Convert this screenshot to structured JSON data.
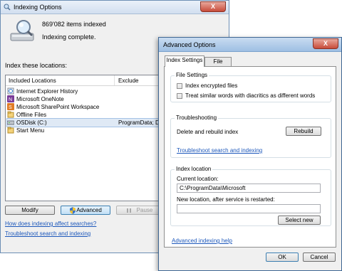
{
  "indexing_window": {
    "title": "Indexing Options",
    "close_label": "X",
    "items_indexed": "869'082 items indexed",
    "status": "Indexing complete.",
    "index_locations_label": "Index these locations:",
    "columns": [
      "Included Locations",
      "Exclude"
    ],
    "locations": [
      {
        "name": "Internet Explorer History",
        "exclude": "",
        "icon": "ie-history-icon"
      },
      {
        "name": "Microsoft OneNote",
        "exclude": "",
        "icon": "onenote-icon"
      },
      {
        "name": "Microsoft SharePoint Workspace",
        "exclude": "",
        "icon": "sharepoint-icon"
      },
      {
        "name": "Offline Files",
        "exclude": "",
        "icon": "offline-files-icon"
      },
      {
        "name": "OSDisk (C:)",
        "exclude": "ProgramData; Data",
        "icon": "disk-icon"
      },
      {
        "name": "Start Menu",
        "exclude": "",
        "icon": "start-menu-icon"
      }
    ],
    "buttons": {
      "modify": "Modify",
      "advanced": "Advanced",
      "pause": "Pause"
    },
    "links": {
      "affect_searches": "How does indexing affect searches?",
      "troubleshoot": "Troubleshoot search and indexing"
    }
  },
  "advanced_dialog": {
    "title": "Advanced Options",
    "close_label": "X",
    "tabs": [
      "Index Settings",
      "File Types"
    ],
    "active_tab": "Index Settings",
    "file_settings": {
      "heading": "File Settings",
      "encrypt_label": "Index encrypted files",
      "encrypt_checked": false,
      "diacritics_label": "Treat similar words with diacritics as different words",
      "diacritics_checked": false
    },
    "troubleshooting": {
      "heading": "Troubleshooting",
      "rebuild_text": "Delete and rebuild index",
      "rebuild_button": "Rebuild",
      "link": "Troubleshoot search and indexing"
    },
    "index_location": {
      "heading": "Index location",
      "current_label": "Current location:",
      "current_value": "C:\\ProgramData\\Microsoft",
      "new_label": "New location, after service is restarted:",
      "new_value": "",
      "select_new_button": "Select new"
    },
    "help_link": "Advanced indexing help",
    "ok": "OK",
    "cancel": "Cancel"
  }
}
